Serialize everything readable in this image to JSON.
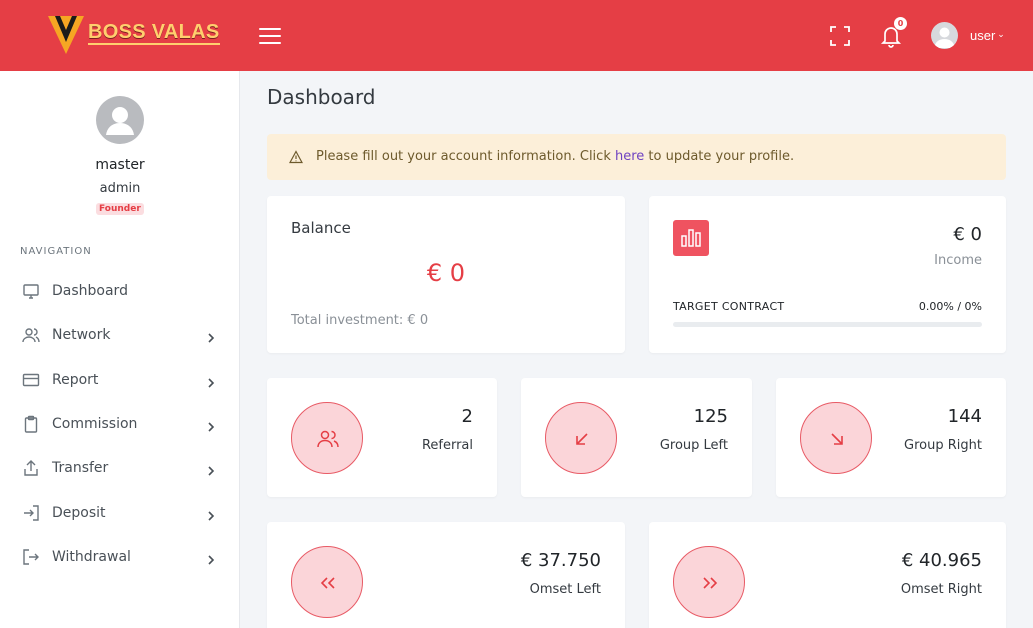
{
  "brand": {
    "name": "BOSS VALAS",
    "accent": "#e53e45"
  },
  "topbar": {
    "menu_icon": "hamburger-icon",
    "fullscreen_icon": "fullscreen-icon",
    "notification_icon": "bell-icon",
    "notification_count": "0",
    "user_label": "user"
  },
  "profile": {
    "name": "master",
    "role": "admin",
    "badge": "Founder"
  },
  "sidebar": {
    "heading": "NAVIGATION",
    "items": [
      {
        "label": "Dashboard",
        "icon": "monitor-icon",
        "has_submenu": false
      },
      {
        "label": "Network",
        "icon": "users-icon",
        "has_submenu": true
      },
      {
        "label": "Report",
        "icon": "credit-card-icon",
        "has_submenu": true
      },
      {
        "label": "Commission",
        "icon": "clipboard-icon",
        "has_submenu": true
      },
      {
        "label": "Transfer",
        "icon": "share-icon",
        "has_submenu": true
      },
      {
        "label": "Deposit",
        "icon": "log-in-icon",
        "has_submenu": true
      },
      {
        "label": "Withdrawal",
        "icon": "log-out-icon",
        "has_submenu": true
      }
    ]
  },
  "main": {
    "title": "Dashboard",
    "alert": {
      "before": "Please fill out your account information. Click ",
      "link": "here",
      "after": " to update your profile."
    },
    "balance": {
      "title": "Balance",
      "value": "€ 0",
      "sub": "Total investment: € 0"
    },
    "income": {
      "value": "€ 0",
      "label": "Income",
      "target_label": "TARGET CONTRACT",
      "target_value": "0.00% / 0%",
      "target_progress": 0
    },
    "stats": [
      {
        "value": "2",
        "label": "Referral",
        "icon": "users-icon"
      },
      {
        "value": "125",
        "label": "Group Left",
        "icon": "arrow-down-left-icon"
      },
      {
        "value": "144",
        "label": "Group Right",
        "icon": "arrow-down-right-icon"
      }
    ],
    "omset": [
      {
        "value": "€ 37.750",
        "label": "Omset Left",
        "icon": "chevrons-left-icon"
      },
      {
        "value": "€ 40.965",
        "label": "Omset Right",
        "icon": "chevrons-right-icon"
      }
    ]
  }
}
